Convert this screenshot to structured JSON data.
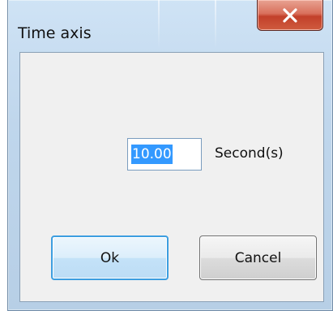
{
  "window": {
    "title": "Time axis"
  },
  "titlebar": {
    "close_icon": "close-x-icon"
  },
  "form": {
    "value": "10.00",
    "unit_label": "Second(s)"
  },
  "buttons": {
    "ok_label": "Ok",
    "cancel_label": "Cancel"
  },
  "colors": {
    "close_button": "#c9533a",
    "selection": "#3399ff",
    "default_button_border": "#3c9ee0"
  }
}
